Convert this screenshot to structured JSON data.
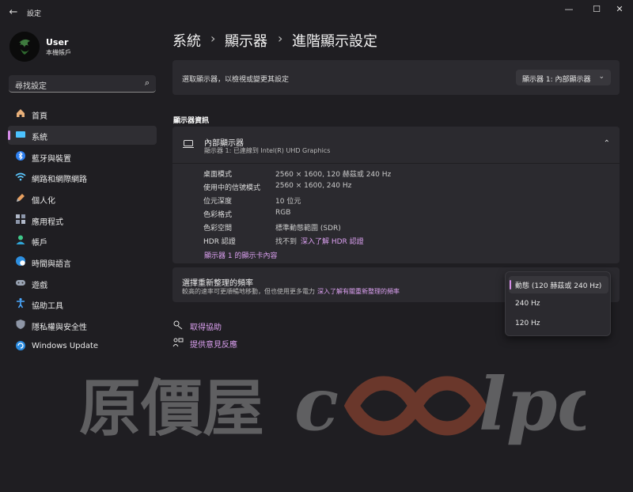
{
  "app": {
    "title": "設定"
  },
  "window": {
    "minimize": "—",
    "maximize": "☐",
    "close": "✕",
    "back": "←"
  },
  "profile": {
    "name": "User",
    "subtitle": "本機帳戶"
  },
  "search": {
    "placeholder": "尋找設定"
  },
  "sidebar": {
    "items": [
      {
        "label": "首頁",
        "icon": "home-icon"
      },
      {
        "label": "系統",
        "icon": "display-icon",
        "active": true
      },
      {
        "label": "藍牙與裝置",
        "icon": "bluetooth-icon"
      },
      {
        "label": "網路和網際網路",
        "icon": "wifi-icon"
      },
      {
        "label": "個人化",
        "icon": "brush-icon"
      },
      {
        "label": "應用程式",
        "icon": "apps-icon"
      },
      {
        "label": "帳戶",
        "icon": "person-icon"
      },
      {
        "label": "時間與語言",
        "icon": "globe-clock-icon"
      },
      {
        "label": "遊戲",
        "icon": "gamepad-icon"
      },
      {
        "label": "協助工具",
        "icon": "accessibility-icon"
      },
      {
        "label": "隱私權與安全性",
        "icon": "shield-icon"
      },
      {
        "label": "Windows Update",
        "icon": "update-icon"
      }
    ]
  },
  "breadcrumb": {
    "items": [
      "系統",
      "顯示器",
      "進階顯示設定"
    ],
    "separator": "›"
  },
  "select_display": {
    "label": "選取顯示器，以檢視或變更其設定",
    "value": "顯示器 1: 內部顯示器"
  },
  "display_info": {
    "section_title": "顯示器資訊",
    "name": "內部顯示器",
    "subtitle": "顯示器 1: 已連線到 Intel(R) UHD Graphics",
    "rows": [
      {
        "key": "桌面模式",
        "value": "2560 × 1600, 120 赫茲或 240 Hz"
      },
      {
        "key": "使用中的信號模式",
        "value": "2560 × 1600, 240 Hz"
      },
      {
        "key": "位元深度",
        "value": "10 位元"
      },
      {
        "key": "色彩格式",
        "value": "RGB"
      },
      {
        "key": "色彩空間",
        "value": "標準動態範圍 (SDR)"
      },
      {
        "key": "HDR 認證",
        "value": "找不到",
        "link": "深入了解 HDR 認證"
      }
    ],
    "adapter_link": "顯示器 1 的顯示卡內容"
  },
  "refresh_rate": {
    "title": "選擇重新整理的頻率",
    "description": "較高的速率可更順暢地移動，但也使用更多電力",
    "link": "深入了解有關重新整理的頻率",
    "options": [
      "動態 (120 赫茲或 240 Hz)",
      "240 Hz",
      "120 Hz"
    ],
    "selected_index": 0
  },
  "footer": {
    "help": "取得協助",
    "feedback": "提供意見反應"
  },
  "watermark": {
    "text": "原價屋coolpc"
  },
  "colors": {
    "accent": "#d58be8",
    "link": "#dba0f0",
    "background": "#1f1e22",
    "card": "#2b2a2f"
  }
}
